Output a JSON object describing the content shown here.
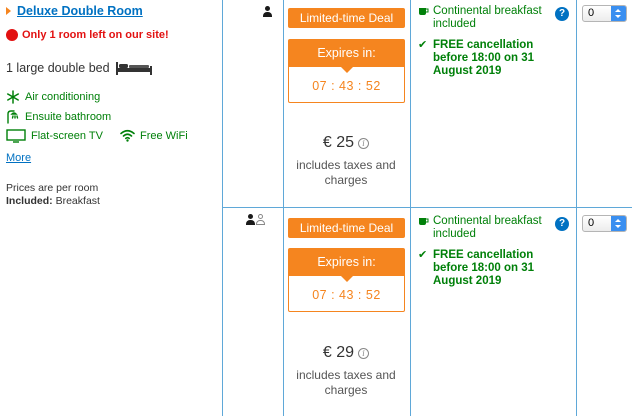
{
  "room": {
    "name": "Deluxe Double Room",
    "scarcity": "Only 1 room left on our site!",
    "bed": "1 large double bed",
    "facilities": [
      "Air conditioning",
      "Ensuite bathroom",
      "Flat-screen TV",
      "Free WiFi"
    ],
    "more_link": "More",
    "prices_note": "Prices are per room",
    "included_label": "Included:",
    "included_value": "Breakfast"
  },
  "rates": [
    {
      "occupancy": 1,
      "deal_badge": "Limited-time Deal",
      "expires_label": "Expires in:",
      "timer": "07 : 43 : 52",
      "price": "€ 25",
      "tax_note": "includes taxes and charges",
      "breakfast": "Continental breakfast included",
      "cancellation": "FREE cancellation before 18:00 on 31 August 2019",
      "select_value": "0"
    },
    {
      "occupancy": 2,
      "deal_badge": "Limited-time Deal",
      "expires_label": "Expires in:",
      "timer": "07 : 43 : 52",
      "price": "€ 29",
      "tax_note": "includes taxes and charges",
      "breakfast": "Continental breakfast included",
      "cancellation": "FREE cancellation before 18:00 on 31 August 2019",
      "select_value": "0"
    }
  ],
  "colors": {
    "link": "#0071c2",
    "deal": "#f5851f",
    "green": "#008009",
    "red": "#e21111",
    "grid": "#5fa8d8"
  }
}
